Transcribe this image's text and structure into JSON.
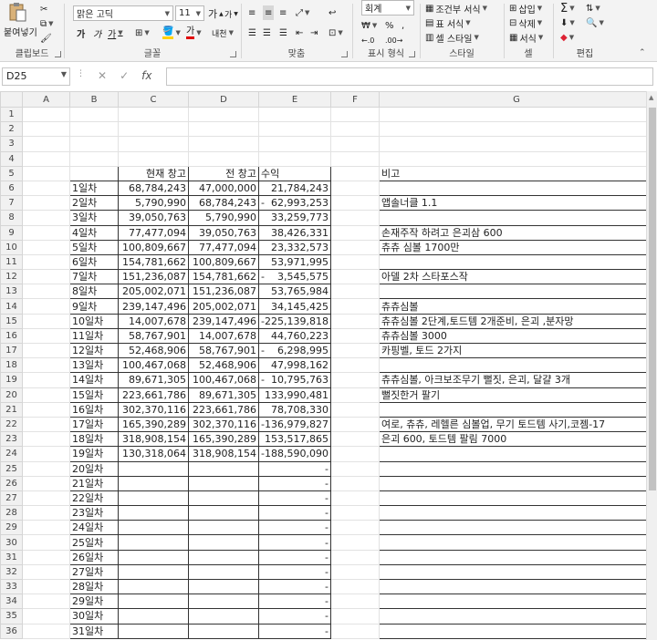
{
  "ribbon": {
    "clipboard": {
      "paste_label": "붙여넣기",
      "group_label": "클립보드"
    },
    "font": {
      "name": "맑은 고딕",
      "size": "11",
      "bold": "가",
      "italic": "가",
      "underline": "가",
      "grow": "가",
      "shrink": "가",
      "phonetic": "내천",
      "group_label": "글꼴"
    },
    "alignment": {
      "group_label": "맞춤"
    },
    "number": {
      "format": "회계",
      "percent": "%",
      "comma": ",",
      "group_label": "표시 형식"
    },
    "styles": {
      "conditional": "조건부 서식",
      "table": "표 서식",
      "cell_styles": "셀 스타일",
      "group_label": "스타일"
    },
    "cells": {
      "insert": "삽입",
      "delete": "삭제",
      "format": "서식",
      "group_label": "셀"
    },
    "editing": {
      "group_label": "편집"
    }
  },
  "formula_bar": {
    "name_box": "D25",
    "cancel": "✕",
    "enter": "✓",
    "fx": "fx",
    "formula": ""
  },
  "columns": [
    "A",
    "B",
    "C",
    "D",
    "E",
    "F",
    "G"
  ],
  "headers_row5": {
    "C": "현재 창고",
    "D": "전 창고",
    "E": "수익",
    "G": "비고"
  },
  "rows": [
    {
      "n": "1"
    },
    {
      "n": "2"
    },
    {
      "n": "3"
    },
    {
      "n": "4"
    },
    {
      "n": "5",
      "C": "현재 창고",
      "D": "전 창고",
      "E": "수익",
      "G": "비고"
    },
    {
      "n": "6",
      "B": "1일차",
      "C": "68,784,243",
      "D": "47,000,000",
      "E": "21,784,243"
    },
    {
      "n": "7",
      "B": "2일차",
      "C": "5,790,990",
      "D": "68,784,243",
      "E": "62,993,253",
      "neg": true,
      "G": "앱솔너클 1.1"
    },
    {
      "n": "8",
      "B": "3일차",
      "C": "39,050,763",
      "D": "5,790,990",
      "E": "33,259,773"
    },
    {
      "n": "9",
      "B": "4일차",
      "C": "77,477,094",
      "D": "39,050,763",
      "E": "38,426,331",
      "G": "손재주작 하려고 은괴삼 600"
    },
    {
      "n": "10",
      "B": "5일차",
      "C": "100,809,667",
      "D": "77,477,094",
      "E": "23,332,573",
      "G": "츄츄 심볼 1700만"
    },
    {
      "n": "11",
      "B": "6일차",
      "C": "154,781,662",
      "D": "100,809,667",
      "E": "53,971,995"
    },
    {
      "n": "12",
      "B": "7일차",
      "C": "151,236,087",
      "D": "154,781,662",
      "E": "3,545,575",
      "neg": true,
      "G": "아델 2차 스타포스작"
    },
    {
      "n": "13",
      "B": "8일차",
      "C": "205,002,071",
      "D": "151,236,087",
      "E": "53,765,984"
    },
    {
      "n": "14",
      "B": "9일차",
      "C": "239,147,496",
      "D": "205,002,071",
      "E": "34,145,425",
      "G": "츄츄심볼"
    },
    {
      "n": "15",
      "B": "10일차",
      "C": "14,007,678",
      "D": "239,147,496",
      "E": "-225,139,818",
      "G": "츄츄심볼 2단계,토드템 2개준비, 은괴 ,분자망"
    },
    {
      "n": "16",
      "B": "11일차",
      "C": "58,767,901",
      "D": "14,007,678",
      "E": "44,760,223",
      "G": "츄츄심볼 3000"
    },
    {
      "n": "17",
      "B": "12일차",
      "C": "52,468,906",
      "D": "58,767,901",
      "E": "6,298,995",
      "neg": true,
      "G": "카핑벨, 토드 2가지"
    },
    {
      "n": "18",
      "B": "13일차",
      "C": "100,467,068",
      "D": "52,468,906",
      "E": "47,998,162"
    },
    {
      "n": "19",
      "B": "14일차",
      "C": "89,671,305",
      "D": "100,467,068",
      "E": "10,795,763",
      "neg": true,
      "G": "츄츄심볼, 아크보조무기 뻘짓, 은괴, 달걀 3개"
    },
    {
      "n": "20",
      "B": "15일차",
      "C": "223,661,786",
      "D": "89,671,305",
      "E": "133,990,481",
      "G": "뻘짓한거 팔기"
    },
    {
      "n": "21",
      "B": "16일차",
      "C": "302,370,116",
      "D": "223,661,786",
      "E": "78,708,330"
    },
    {
      "n": "22",
      "B": "17일차",
      "C": "165,390,289",
      "D": "302,370,116",
      "E": "-136,979,827",
      "G": "여로, 츄츄, 레헬른 심볼업, 무기 토드템 사기,코젬-17"
    },
    {
      "n": "23",
      "B": "18일차",
      "C": "318,908,154",
      "D": "165,390,289",
      "E": "153,517,865",
      "G": "은괴 600, 토드템 팔림 7000"
    },
    {
      "n": "24",
      "B": "19일차",
      "C": "130,318,064",
      "D": "318,908,154",
      "E": "-188,590,090"
    },
    {
      "n": "25",
      "B": "20일차",
      "E": "-"
    },
    {
      "n": "26",
      "B": "21일차",
      "E": "-"
    },
    {
      "n": "27",
      "B": "22일차",
      "E": "-"
    },
    {
      "n": "28",
      "B": "23일차",
      "E": "-"
    },
    {
      "n": "29",
      "B": "24일차",
      "E": "-"
    },
    {
      "n": "30",
      "B": "25일차",
      "E": "-"
    },
    {
      "n": "31",
      "B": "26일차",
      "E": "-"
    },
    {
      "n": "32",
      "B": "27일차",
      "E": "-"
    },
    {
      "n": "33",
      "B": "28일차",
      "E": "-"
    },
    {
      "n": "34",
      "B": "29일차",
      "E": "-"
    },
    {
      "n": "35",
      "B": "30일차",
      "E": "-"
    },
    {
      "n": "36",
      "B": "31일차",
      "E": "-"
    }
  ]
}
